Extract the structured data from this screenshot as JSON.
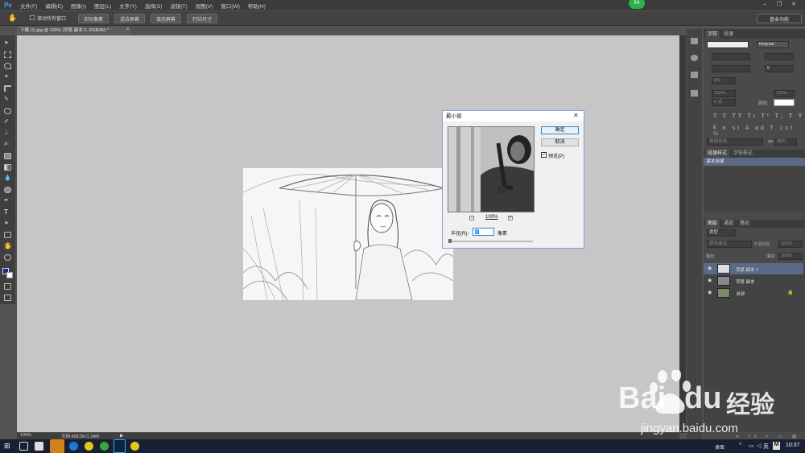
{
  "app": {
    "logo": "Ps"
  },
  "menu": [
    "文件(F)",
    "编辑(E)",
    "图像(I)",
    "图层(L)",
    "文字(Y)",
    "选择(S)",
    "滤镜(T)",
    "视图(V)",
    "窗口(W)",
    "帮助(H)"
  ],
  "badge": "54",
  "options_bar": {
    "checkbox_label": "滚动所有窗口",
    "buttons": [
      "实际像素",
      "适合屏幕",
      "填充屏幕",
      "打印尺寸"
    ],
    "workspace": "基本功能"
  },
  "document": {
    "tab_title": "下载 (1).jpg @ 100% (背景 副本 2, RGB/8#) *",
    "zoom": "100%",
    "doc_size": "文档:458.5K/1.34M"
  },
  "dialog": {
    "title": "最小值",
    "ok": "确定",
    "cancel": "取消",
    "preview_label": "预览(P)",
    "preview_checked": true,
    "zoom": "100%",
    "radius_label": "半径(R):",
    "radius_value": "1",
    "unit": "像素"
  },
  "char_panel": {
    "tabs": [
      "字符",
      "段落"
    ],
    "font_style": "Regular",
    "leading": "5",
    "tracking": "0%",
    "scale_v": "100%",
    "scale_h": "100%",
    "color_label": "颜色:",
    "baseline": "0 点",
    "lang": "美国英语",
    "aa": "锐利",
    "aa_prefix": "aa"
  },
  "para_styles": {
    "tabs": [
      "段落样式",
      "字符样式"
    ],
    "item": "基本段落"
  },
  "layers_panel": {
    "tabs": [
      "图层",
      "通道",
      "路径"
    ],
    "filter": "类型",
    "blend": "颜色减淡",
    "opacity_label": "不透明度:",
    "opacity": "100%",
    "lock_label": "锁定:",
    "fill_label": "填充:",
    "fill": "100%",
    "layers": [
      {
        "name": "背景 副本 2",
        "selected": true
      },
      {
        "name": "背景 副本",
        "selected": false
      },
      {
        "name": "背景",
        "selected": false
      }
    ]
  },
  "taskbar": {
    "right_label": "桌面",
    "ime": "英",
    "time": "10:37"
  },
  "watermark": {
    "brand_left": "Bai",
    "brand_right": "du",
    "product": "经验",
    "url": "jingyan.baidu.com"
  }
}
